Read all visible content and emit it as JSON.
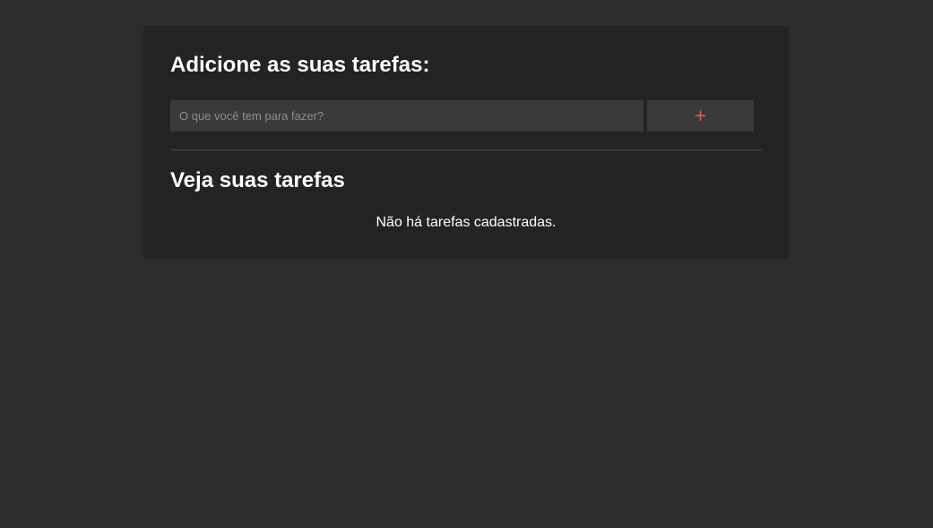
{
  "colors": {
    "page_background": "#2c2c2c",
    "card_background": "#232323",
    "input_background": "#3a3a3a",
    "accent": "#e8604c",
    "text": "#ffffff"
  },
  "add_section": {
    "title": "Adicione as suas tarefas:",
    "input": {
      "value": "",
      "placeholder": "O que você tem para fazer?"
    },
    "add_button": {
      "label": "+",
      "icon": "plus-icon"
    }
  },
  "list_section": {
    "title": "Veja suas tarefas",
    "empty_message": "Não há tarefas cadastradas.",
    "tasks": []
  }
}
